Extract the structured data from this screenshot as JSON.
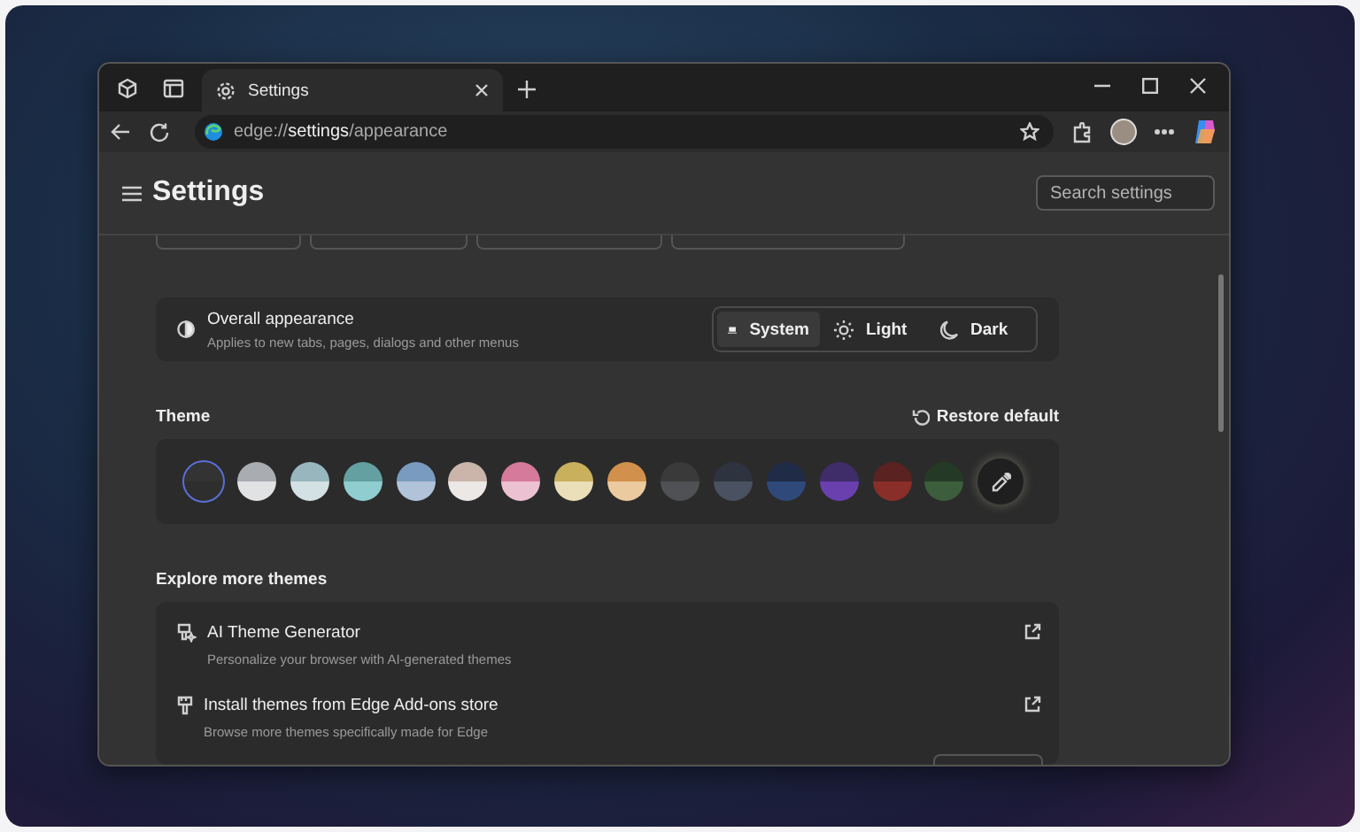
{
  "tabs": [
    {
      "label": "Settings",
      "selected": true
    }
  ],
  "address_bar": {
    "url": "edge://**settings**/appearance"
  },
  "header": {
    "title": "Settings",
    "search": {
      "placeholder": "Search settings"
    }
  },
  "appearance": {
    "title": "Overall appearance",
    "description": "Applies to new tabs, pages, dialogs and other menus",
    "options": [
      {
        "kind": "system",
        "label": "System",
        "selected": true
      },
      {
        "kind": "light",
        "label": "Light",
        "selected": false
      },
      {
        "kind": "dark",
        "label": "Dark",
        "selected": false
      }
    ]
  },
  "theme": {
    "title": "Theme",
    "restore": "Restore default",
    "swatches": [
      {
        "selected": true,
        "halves": [
          {
            "color": "#333333"
          },
          {
            "color": "#2e2e2e"
          }
        ]
      },
      {
        "selected": false,
        "halves": [
          {
            "color": "#a9adb1"
          },
          {
            "color": "#e1e2e4"
          }
        ]
      },
      {
        "selected": false,
        "halves": [
          {
            "color": "#98b6bd"
          },
          {
            "color": "#d4e1e4"
          }
        ]
      },
      {
        "selected": false,
        "halves": [
          {
            "color": "#64a0a2"
          },
          {
            "color": "#8fcdd0"
          }
        ]
      },
      {
        "selected": false,
        "halves": [
          {
            "color": "#7a9bc0"
          },
          {
            "color": "#b1c3d9"
          }
        ]
      },
      {
        "selected": false,
        "halves": [
          {
            "color": "#cbb5ab"
          },
          {
            "color": "#ece8e6"
          }
        ]
      },
      {
        "selected": false,
        "halves": [
          {
            "color": "#d57a9b"
          },
          {
            "color": "#ecc1d1"
          }
        ]
      },
      {
        "selected": false,
        "halves": [
          {
            "color": "#c9b05d"
          },
          {
            "color": "#ebdfb9"
          }
        ]
      },
      {
        "selected": false,
        "halves": [
          {
            "color": "#d1914d"
          },
          {
            "color": "#eccaa0"
          }
        ]
      },
      {
        "selected": false,
        "halves": [
          {
            "color": "#3a3a3a"
          },
          {
            "color": "#505154"
          }
        ]
      },
      {
        "selected": false,
        "halves": [
          {
            "color": "#2e3340"
          },
          {
            "color": "#4a5261"
          }
        ]
      },
      {
        "selected": false,
        "halves": [
          {
            "color": "#1f2b47"
          },
          {
            "color": "#2f4a7a"
          }
        ]
      },
      {
        "selected": false,
        "halves": [
          {
            "color": "#3f2d6a"
          },
          {
            "color": "#6a3fae"
          }
        ]
      },
      {
        "selected": false,
        "halves": [
          {
            "color": "#5a2220"
          },
          {
            "color": "#8a2e2a"
          }
        ]
      },
      {
        "selected": false,
        "halves": [
          {
            "color": "#253a26"
          },
          {
            "color": "#3d5e3c"
          }
        ]
      }
    ]
  },
  "explore": {
    "title": "Explore more themes",
    "items": [
      {
        "kind": "ai",
        "title": "AI Theme Generator",
        "description": "Personalize your browser with AI-generated themes"
      },
      {
        "kind": "store",
        "title": "Install themes from Edge Add-ons store",
        "description": "Browse more themes specifically made for Edge"
      }
    ]
  }
}
